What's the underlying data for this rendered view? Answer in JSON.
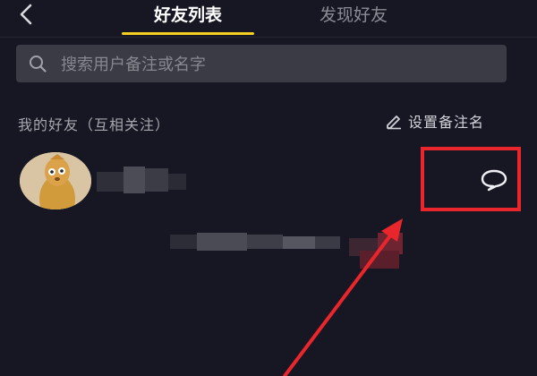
{
  "topbar": {
    "back_icon": "chevron-left-icon",
    "tabs": [
      {
        "label": "好友列表",
        "active": true
      },
      {
        "label": "发现好友",
        "active": false
      }
    ],
    "active_color": "#f4cf22"
  },
  "search": {
    "placeholder": "搜索用户备注或名字",
    "icon": "search-icon"
  },
  "section": {
    "title": "我的好友（互相关注）",
    "set_remark_label": "设置备注名",
    "set_remark_icon": "pencil-icon"
  },
  "friend": {
    "avatar_icon": "avatar",
    "action_icon": "chat-bubble-icon",
    "highlight_color": "#e8262c"
  },
  "annotation": {
    "arrow_color": "#e8262c"
  }
}
